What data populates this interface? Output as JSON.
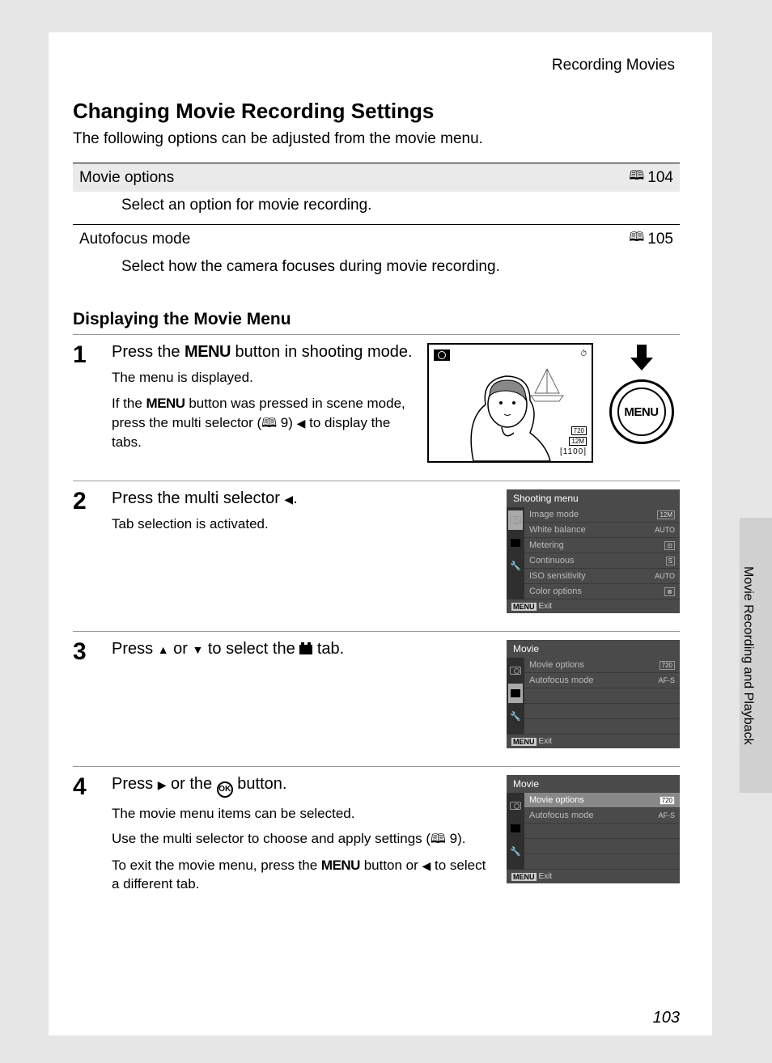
{
  "page_context": "Recording Movies",
  "title": "Changing Movie Recording Settings",
  "intro": "The following options can be adjusted from the movie menu.",
  "options": [
    {
      "name": "Movie options",
      "page": "104",
      "desc": "Select an option for movie recording."
    },
    {
      "name": "Autofocus mode",
      "page": "105",
      "desc": "Select how the camera focuses during movie recording."
    }
  ],
  "subhead": "Displaying the Movie Menu",
  "steps": {
    "s1": {
      "num": "1",
      "main_a": "Press the ",
      "main_b": "MENU",
      "main_c": " button in shooting mode.",
      "sub1": "The menu is displayed.",
      "sub2_a": "If the ",
      "sub2_b": "MENU",
      "sub2_c": " button was pressed in scene mode, press the multi selector (",
      "sub2_d": " 9) ",
      "sub2_e": " to display the tabs.",
      "menu_label": "MENU",
      "lcd_counter": "[1100]",
      "lcd_res": "720",
      "lcd_size": "12M"
    },
    "s2": {
      "num": "2",
      "main_a": "Press the multi selector ",
      "main_b": ".",
      "sub1": "Tab selection is activated.",
      "menu_title": "Shooting menu",
      "rows": [
        {
          "label": "Image mode",
          "val": "12M"
        },
        {
          "label": "White balance",
          "val": "AUTO"
        },
        {
          "label": "Metering",
          "val": ""
        },
        {
          "label": "Continuous",
          "val": "S"
        },
        {
          "label": "ISO sensitivity",
          "val": "AUTO"
        },
        {
          "label": "Color options",
          "val": ""
        }
      ],
      "exit": "Exit"
    },
    "s3": {
      "num": "3",
      "main_a": "Press ",
      "main_b": " or ",
      "main_c": " to select the ",
      "main_d": " tab.",
      "menu_title": "Movie",
      "rows": [
        {
          "label": "Movie options",
          "val": "720"
        },
        {
          "label": "Autofocus mode",
          "val": "AF-S"
        }
      ],
      "exit": "Exit"
    },
    "s4": {
      "num": "4",
      "main_a": "Press ",
      "main_b": " or the ",
      "main_c": " button.",
      "sub1": "The movie menu items can be selected.",
      "sub2_a": "Use the multi selector to choose and apply settings (",
      "sub2_b": " 9).",
      "sub3_a": "To exit the movie menu, press the ",
      "sub3_b": "MENU",
      "sub3_c": " button or ",
      "sub3_d": " to select a different tab.",
      "menu_title": "Movie",
      "rows": [
        {
          "label": "Movie options",
          "val": "720"
        },
        {
          "label": "Autofocus mode",
          "val": "AF-S"
        }
      ],
      "exit": "Exit"
    }
  },
  "side_label": "Movie Recording and Playback",
  "page_num": "103",
  "menu_badge": "MENU",
  "ok_label": "OK"
}
